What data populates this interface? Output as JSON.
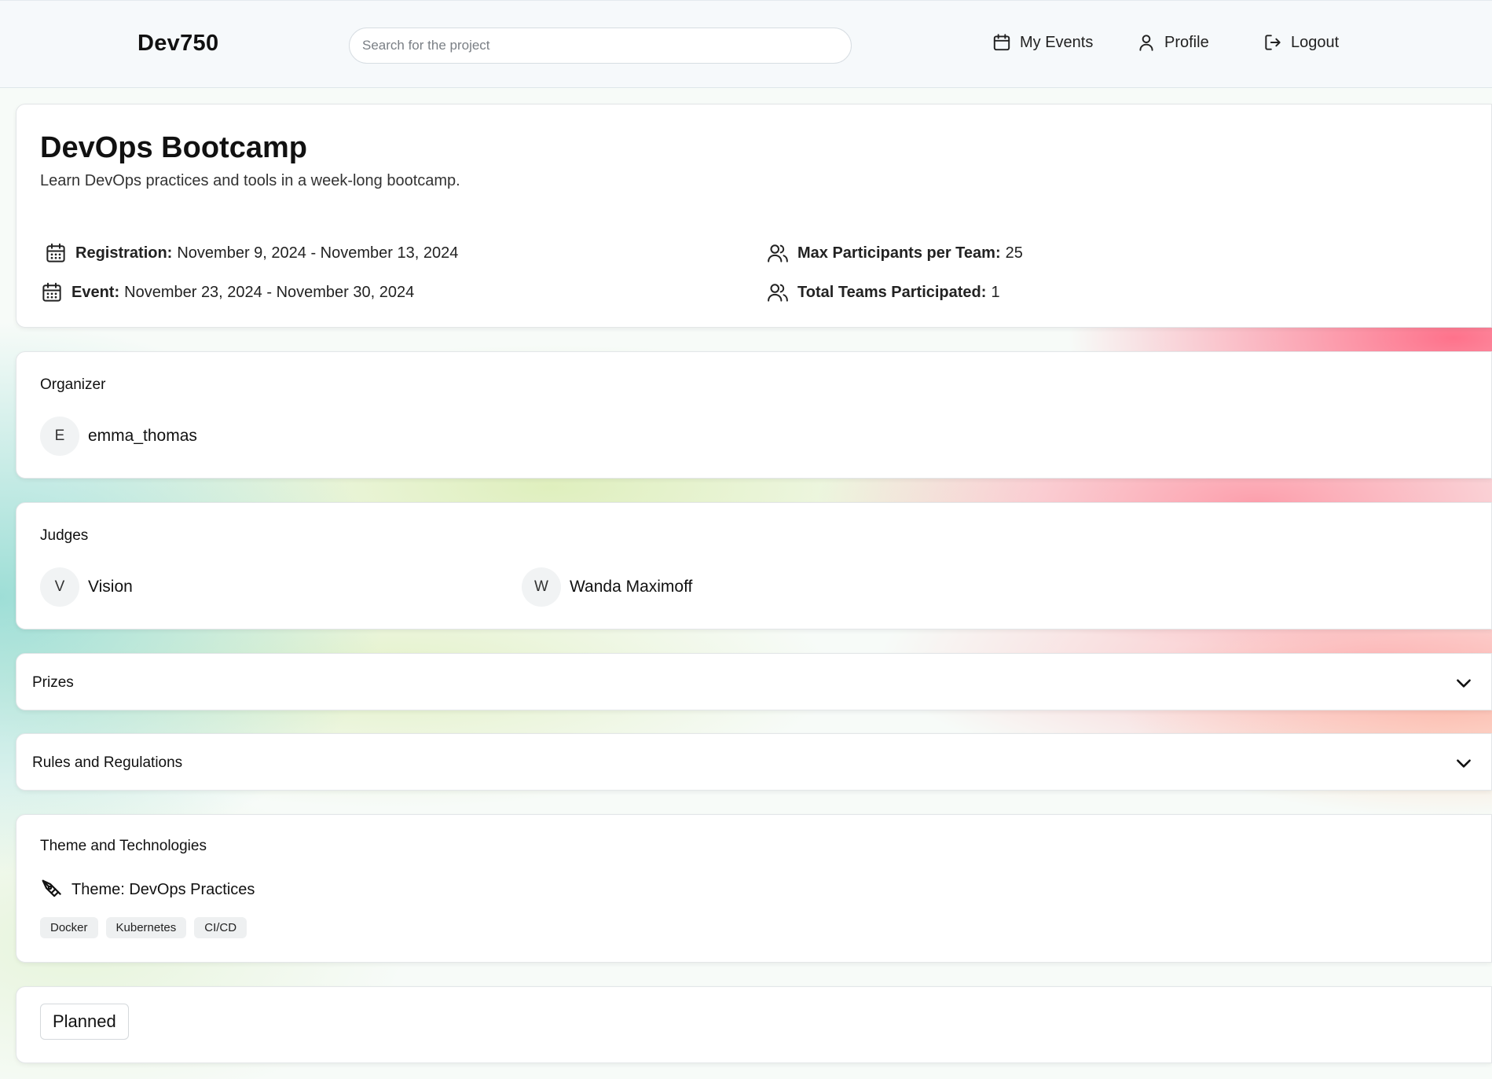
{
  "app": {
    "brand": "Dev750"
  },
  "search": {
    "placeholder": "Search for the project"
  },
  "nav": {
    "my_events": "My Events",
    "profile": "Profile",
    "logout": "Logout"
  },
  "event": {
    "title": "DevOps Bootcamp",
    "description": "Learn DevOps practices and tools in a week-long bootcamp.",
    "registration_label": "Registration:",
    "registration_value": "November 9, 2024 - November 13, 2024",
    "event_label": "Event:",
    "event_value": "November 23, 2024 - November 30, 2024",
    "max_participants_label": "Max Participants per Team:",
    "max_participants_value": "25",
    "total_teams_label": "Total Teams Participated:",
    "total_teams_value": "1"
  },
  "organizer": {
    "heading": "Organizer",
    "initial": "E",
    "name": "emma_thomas"
  },
  "judges": {
    "heading": "Judges",
    "items": [
      {
        "initial": "V",
        "name": "Vision"
      },
      {
        "initial": "W",
        "name": "Wanda Maximoff"
      }
    ]
  },
  "prizes": {
    "label": "Prizes"
  },
  "rules": {
    "label": "Rules and Regulations"
  },
  "theme": {
    "heading": "Theme and Technologies",
    "theme_text": "Theme: DevOps Practices",
    "tags": [
      "Docker",
      "Kubernetes",
      "CI/CD"
    ]
  },
  "status": {
    "label": "Planned"
  },
  "icons": {
    "calendar": "calendar-icon",
    "user": "user-icon",
    "logout": "logout-icon",
    "users": "users-icon",
    "pen": "pen-tool-icon",
    "chevron": "chevron-down-icon"
  }
}
